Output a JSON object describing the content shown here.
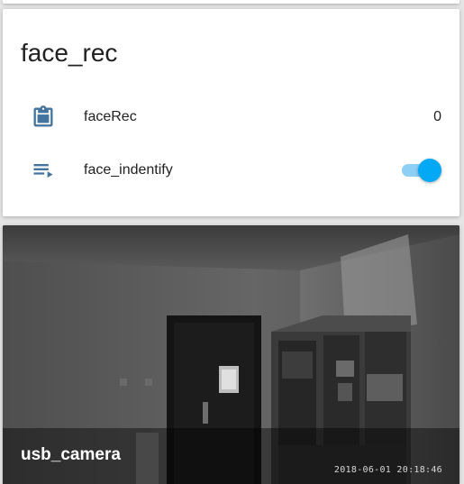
{
  "card": {
    "title": "face_rec",
    "rows": [
      {
        "icon": "clipboard-icon",
        "label": "faceRec",
        "value": "0"
      },
      {
        "icon": "playlist-play-icon",
        "label": "face_indentify",
        "toggle_on": true
      }
    ]
  },
  "camera": {
    "name": "usb_camera",
    "timestamp": "2018-06-01 20:18:46"
  },
  "colors": {
    "icon": "#44739e",
    "toggle_accent": "#03a9f4",
    "toggle_track": "#8ecff5",
    "text": "#212121"
  }
}
